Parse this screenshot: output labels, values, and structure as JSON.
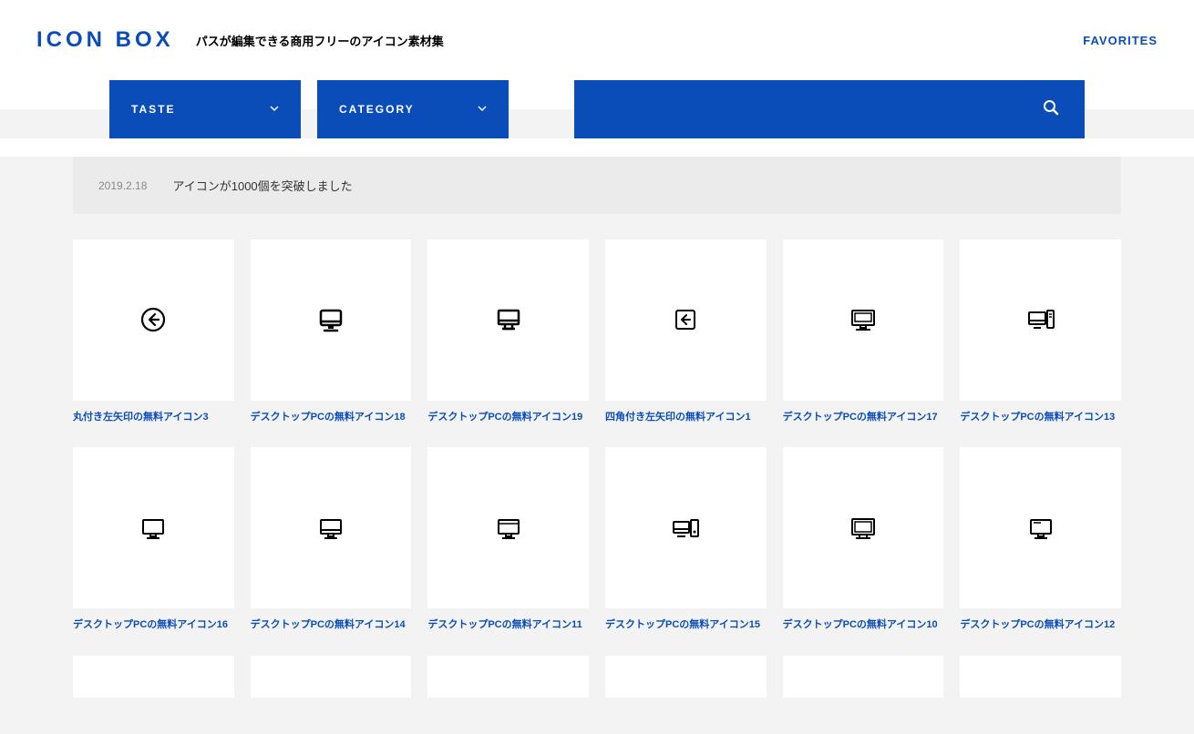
{
  "header": {
    "logo": "ICON BOX",
    "tagline": "パスが編集できる商用フリーのアイコン素材集",
    "favorites": "FAVORITES"
  },
  "controls": {
    "taste_label": "TASTE",
    "category_label": "CATEGORY",
    "search_placeholder": ""
  },
  "notice": {
    "date": "2019.2.18",
    "text": "アイコンが1000個を突破しました"
  },
  "icons_row1": [
    {
      "title": "丸付き左矢印の無料アイコン3",
      "icon": "arrow-circle-left"
    },
    {
      "title": "デスクトップPCの無料アイコン18",
      "icon": "desktop-18"
    },
    {
      "title": "デスクトップPCの無料アイコン19",
      "icon": "desktop-19"
    },
    {
      "title": "四角付き左矢印の無料アイコン1",
      "icon": "arrow-square-left"
    },
    {
      "title": "デスクトップPCの無料アイコン17",
      "icon": "desktop-17"
    },
    {
      "title": "デスクトップPCの無料アイコン13",
      "icon": "desktop-tower-13"
    }
  ],
  "icons_row2": [
    {
      "title": "デスクトップPCの無料アイコン16",
      "icon": "desktop-16"
    },
    {
      "title": "デスクトップPCの無料アイコン14",
      "icon": "desktop-14"
    },
    {
      "title": "デスクトップPCの無料アイコン11",
      "icon": "desktop-11"
    },
    {
      "title": "デスクトップPCの無料アイコン15",
      "icon": "desktop-tower-15"
    },
    {
      "title": "デスクトップPCの無料アイコン10",
      "icon": "desktop-10"
    },
    {
      "title": "デスクトップPCの無料アイコン12",
      "icon": "desktop-12"
    }
  ]
}
